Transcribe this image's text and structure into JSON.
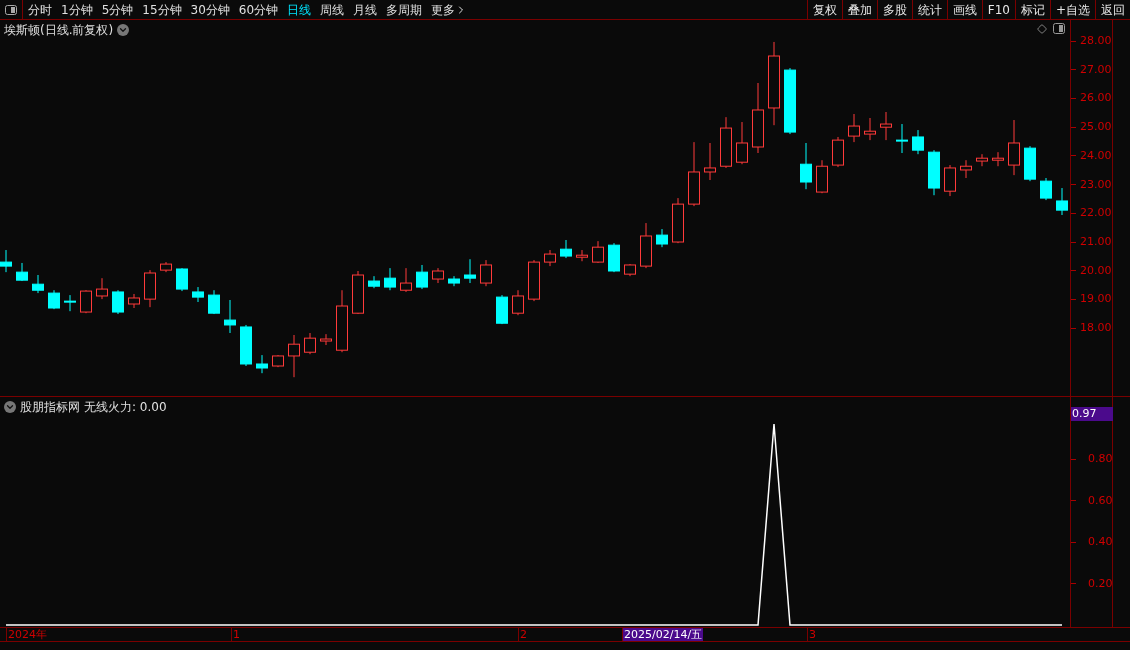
{
  "toolbar": {
    "periods": [
      {
        "label": "分时",
        "selected": false
      },
      {
        "label": "1分钟",
        "selected": false
      },
      {
        "label": "5分钟",
        "selected": false
      },
      {
        "label": "15分钟",
        "selected": false
      },
      {
        "label": "30分钟",
        "selected": false
      },
      {
        "label": "60分钟",
        "selected": false
      },
      {
        "label": "日线",
        "selected": true
      },
      {
        "label": "周线",
        "selected": false
      },
      {
        "label": "月线",
        "selected": false
      },
      {
        "label": "多周期",
        "selected": false
      }
    ],
    "more": "更多",
    "tools": [
      "复权",
      "叠加",
      "多股",
      "统计",
      "画线",
      "F10",
      "标记",
      "+自选",
      "返回"
    ]
  },
  "chart": {
    "title": "埃斯顿(日线.前复权)",
    "chart_data": {
      "type": "candlestick",
      "ylim": [
        15.6,
        28.7
      ],
      "ohlc": [
        [
          20.3,
          20.72,
          19.95,
          20.16
        ],
        [
          19.95,
          20.27,
          19.64,
          19.67
        ],
        [
          19.53,
          19.85,
          19.22,
          19.32
        ],
        [
          19.22,
          19.32,
          18.66,
          18.7
        ],
        [
          18.94,
          19.15,
          18.59,
          18.91
        ],
        [
          18.56,
          19.32,
          18.52,
          19.29
        ],
        [
          19.12,
          19.74,
          19.01,
          19.36
        ],
        [
          19.26,
          19.32,
          18.49,
          18.56
        ],
        [
          18.84,
          19.19,
          18.7,
          19.05
        ],
        [
          19.01,
          20.02,
          18.73,
          19.92
        ],
        [
          20.02,
          20.3,
          19.95,
          20.23
        ],
        [
          20.06,
          20.09,
          19.29,
          19.36
        ],
        [
          19.26,
          19.43,
          18.91,
          19.08
        ],
        [
          19.15,
          19.32,
          18.49,
          18.52
        ],
        [
          18.28,
          18.98,
          17.83,
          18.11
        ],
        [
          18.04,
          18.11,
          16.68,
          16.75
        ],
        [
          16.75,
          17.06,
          16.43,
          16.61
        ],
        [
          16.68,
          17.06,
          16.64,
          17.03
        ],
        [
          17.03,
          17.76,
          16.29,
          17.44
        ],
        [
          17.16,
          17.83,
          17.09,
          17.65
        ],
        [
          17.55,
          17.79,
          17.41,
          17.62
        ],
        [
          17.23,
          19.32,
          17.16,
          18.77
        ],
        [
          18.52,
          19.99,
          18.49,
          19.85
        ],
        [
          19.64,
          19.81,
          19.39,
          19.46
        ],
        [
          19.74,
          20.09,
          19.32,
          19.43
        ],
        [
          19.32,
          20.09,
          19.26,
          19.57
        ],
        [
          19.95,
          20.2,
          19.36,
          19.43
        ],
        [
          19.71,
          20.09,
          19.57,
          19.99
        ],
        [
          19.71,
          19.81,
          19.46,
          19.57
        ],
        [
          19.85,
          20.4,
          19.57,
          19.74
        ],
        [
          19.57,
          20.37,
          19.46,
          20.2
        ],
        [
          19.08,
          19.15,
          18.14,
          18.17
        ],
        [
          18.52,
          19.32,
          18.45,
          19.12
        ],
        [
          19.01,
          20.37,
          18.94,
          20.3
        ],
        [
          20.3,
          20.72,
          20.16,
          20.58
        ],
        [
          20.75,
          21.07,
          20.44,
          20.51
        ],
        [
          20.47,
          20.72,
          20.33,
          20.54
        ],
        [
          20.3,
          21.03,
          20.27,
          20.82
        ],
        [
          20.89,
          20.96,
          19.95,
          19.99
        ],
        [
          19.88,
          20.23,
          19.81,
          20.2
        ],
        [
          20.16,
          21.66,
          20.09,
          21.21
        ],
        [
          21.24,
          21.45,
          20.82,
          20.93
        ],
        [
          21.0,
          22.53,
          20.96,
          22.32
        ],
        [
          22.32,
          24.48,
          22.25,
          23.44
        ],
        [
          23.44,
          24.45,
          23.16,
          23.58
        ],
        [
          23.64,
          25.35,
          23.58,
          24.97
        ],
        [
          23.78,
          25.18,
          23.71,
          24.45
        ],
        [
          24.31,
          26.54,
          24.1,
          25.6
        ],
        [
          25.67,
          27.97,
          25.07,
          27.48
        ],
        [
          26.99,
          27.06,
          24.76,
          24.83
        ],
        [
          23.71,
          24.45,
          22.84,
          23.09
        ],
        [
          22.74,
          23.85,
          22.7,
          23.64
        ],
        [
          23.68,
          24.66,
          23.61,
          24.55
        ],
        [
          24.69,
          25.46,
          24.48,
          25.04
        ],
        [
          24.76,
          25.32,
          24.55,
          24.86
        ],
        [
          25.0,
          25.53,
          24.55,
          25.11
        ],
        [
          24.55,
          25.11,
          24.1,
          24.52
        ],
        [
          24.66,
          24.9,
          24.06,
          24.2
        ],
        [
          24.13,
          24.2,
          22.63,
          22.88
        ],
        [
          22.77,
          23.68,
          22.6,
          23.58
        ],
        [
          23.51,
          23.85,
          23.23,
          23.64
        ],
        [
          23.82,
          24.06,
          23.64,
          23.92
        ],
        [
          23.85,
          24.13,
          23.64,
          23.92
        ],
        [
          23.68,
          25.25,
          23.33,
          24.45
        ],
        [
          24.27,
          24.34,
          23.12,
          23.19
        ],
        [
          23.12,
          23.23,
          22.46,
          22.53
        ],
        [
          22.43,
          22.88,
          21.94,
          22.11
        ]
      ],
      "yticks": [
        {
          "value": 28,
          "label": "28.00"
        },
        {
          "value": 27,
          "label": "27.00"
        },
        {
          "value": 26,
          "label": "26.00"
        },
        {
          "value": 25,
          "label": "25.00"
        },
        {
          "value": 24,
          "label": "24.00"
        },
        {
          "value": 23,
          "label": "23.00"
        },
        {
          "value": 22,
          "label": "22.00"
        },
        {
          "value": 21,
          "label": "21.00"
        },
        {
          "value": 20,
          "label": "20.00"
        },
        {
          "value": 19,
          "label": "19.00"
        },
        {
          "value": 18,
          "label": "18.00"
        }
      ]
    }
  },
  "indicator": {
    "name": "股朋指标网",
    "formula": "无线火力: 0.00",
    "current": "0.97",
    "chart_data": {
      "type": "line",
      "ylim": [
        0,
        1.1
      ],
      "yticks": [
        {
          "value": 0.8,
          "label": "0.80"
        },
        {
          "value": 0.6,
          "label": "0.60"
        },
        {
          "value": 0.4,
          "label": "0.40"
        },
        {
          "value": 0.2,
          "label": "0.20"
        }
      ],
      "values": [
        0,
        0,
        0,
        0,
        0,
        0,
        0,
        0,
        0,
        0,
        0,
        0,
        0,
        0,
        0,
        0,
        0,
        0,
        0,
        0,
        0,
        0,
        0,
        0,
        0,
        0,
        0,
        0,
        0,
        0,
        0,
        0,
        0,
        0,
        0,
        0,
        0,
        0,
        0,
        0,
        0,
        0,
        0,
        0,
        0,
        0,
        0,
        0,
        0.97,
        0,
        0,
        0,
        0,
        0,
        0,
        0,
        0,
        0,
        0,
        0,
        0,
        0,
        0,
        0,
        0,
        0,
        0
      ]
    }
  },
  "time_axis": [
    {
      "label": "2024年",
      "selected": false
    },
    {
      "label": "1",
      "selected": false
    },
    {
      "label": "2",
      "selected": false
    },
    {
      "label": "2025/02/14/五",
      "selected": true
    },
    {
      "label": "3",
      "selected": false
    }
  ]
}
